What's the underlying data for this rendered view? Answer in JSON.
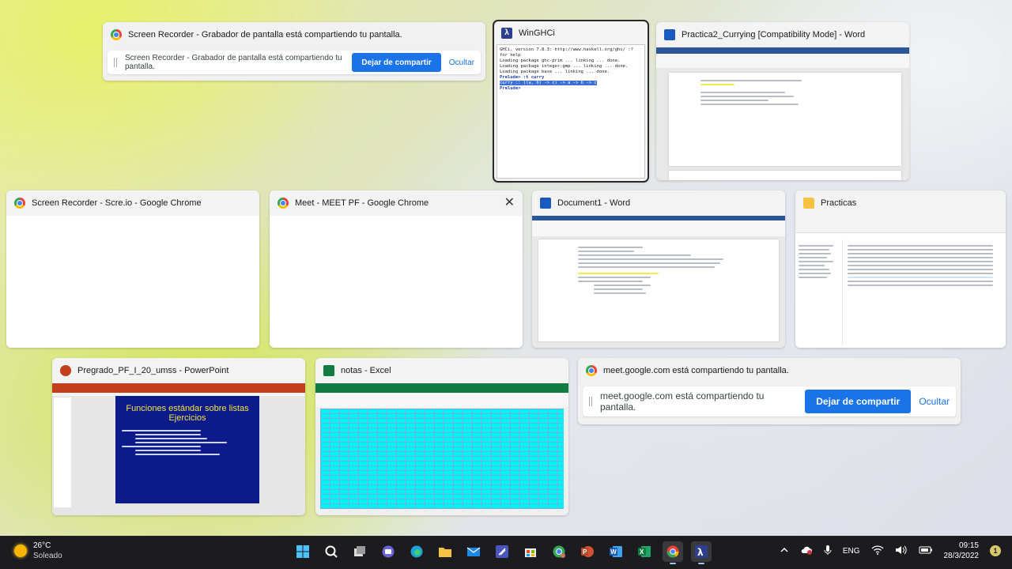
{
  "windows": {
    "screen_recorder_share": {
      "title": "Screen Recorder - Grabador de pantalla está compartiendo tu pantalla.",
      "bar_text": "Screen Recorder - Grabador de pantalla está compartiendo tu pantalla.",
      "stop_label": "Dejar de compartir",
      "hide_label": "Ocultar"
    },
    "winghci": {
      "title": "WinGHCi",
      "lines": [
        "GHCi, version 7.8.3: http://www.haskell.org/ghc/  :? for help",
        "Loading package ghc-prim ... linking ... done.",
        "Loading package integer-gmp ... linking ... done.",
        "Loading package base ... linking ... done."
      ],
      "prompt1": "Prelude> :t curry",
      "result": "curry :: ((a, b) -> c) -> a -> b -> c",
      "prompt2": "Prelude>"
    },
    "practica2": {
      "title": "Practica2_Currying [Compatibility Mode] - Word"
    },
    "scre_io": {
      "title": "Screen Recorder - Scre.io - Google Chrome"
    },
    "meet": {
      "title": "Meet - MEET PF - Google Chrome",
      "close": "✕"
    },
    "document1": {
      "title": "Document1 - Word"
    },
    "practicas": {
      "title": "Practicas"
    },
    "powerpoint": {
      "title": "Pregrado_PF_I_20_umss - PowerPoint",
      "slide_title": "Funciones estándar sobre listas",
      "slide_subtitle": "Ejercicios"
    },
    "excel": {
      "title": "notas - Excel"
    },
    "meet_share": {
      "title": "meet.google.com está compartiendo tu pantalla.",
      "bar_text": "meet.google.com está compartiendo tu pantalla.",
      "stop_label": "Dejar de compartir",
      "hide_label": "Ocultar"
    }
  },
  "taskbar": {
    "weather": {
      "temp": "26°C",
      "condition": "Soleado"
    },
    "apps": [
      "windows-start-icon",
      "search-icon",
      "task-view-icon",
      "chat-icon",
      "edge-icon",
      "file-explorer-icon",
      "mail-icon",
      "visual-studio-icon",
      "store-icon",
      "chrome-profile-icon",
      "powerpoint-icon",
      "word-icon",
      "excel-icon",
      "chrome-icon",
      "winghci-icon"
    ],
    "language": "ENG",
    "time": "09:15",
    "date": "28/3/2022",
    "notifications": "1"
  },
  "colors": {
    "accent": "#1a73e8",
    "taskbar": "#1c1c1e"
  }
}
